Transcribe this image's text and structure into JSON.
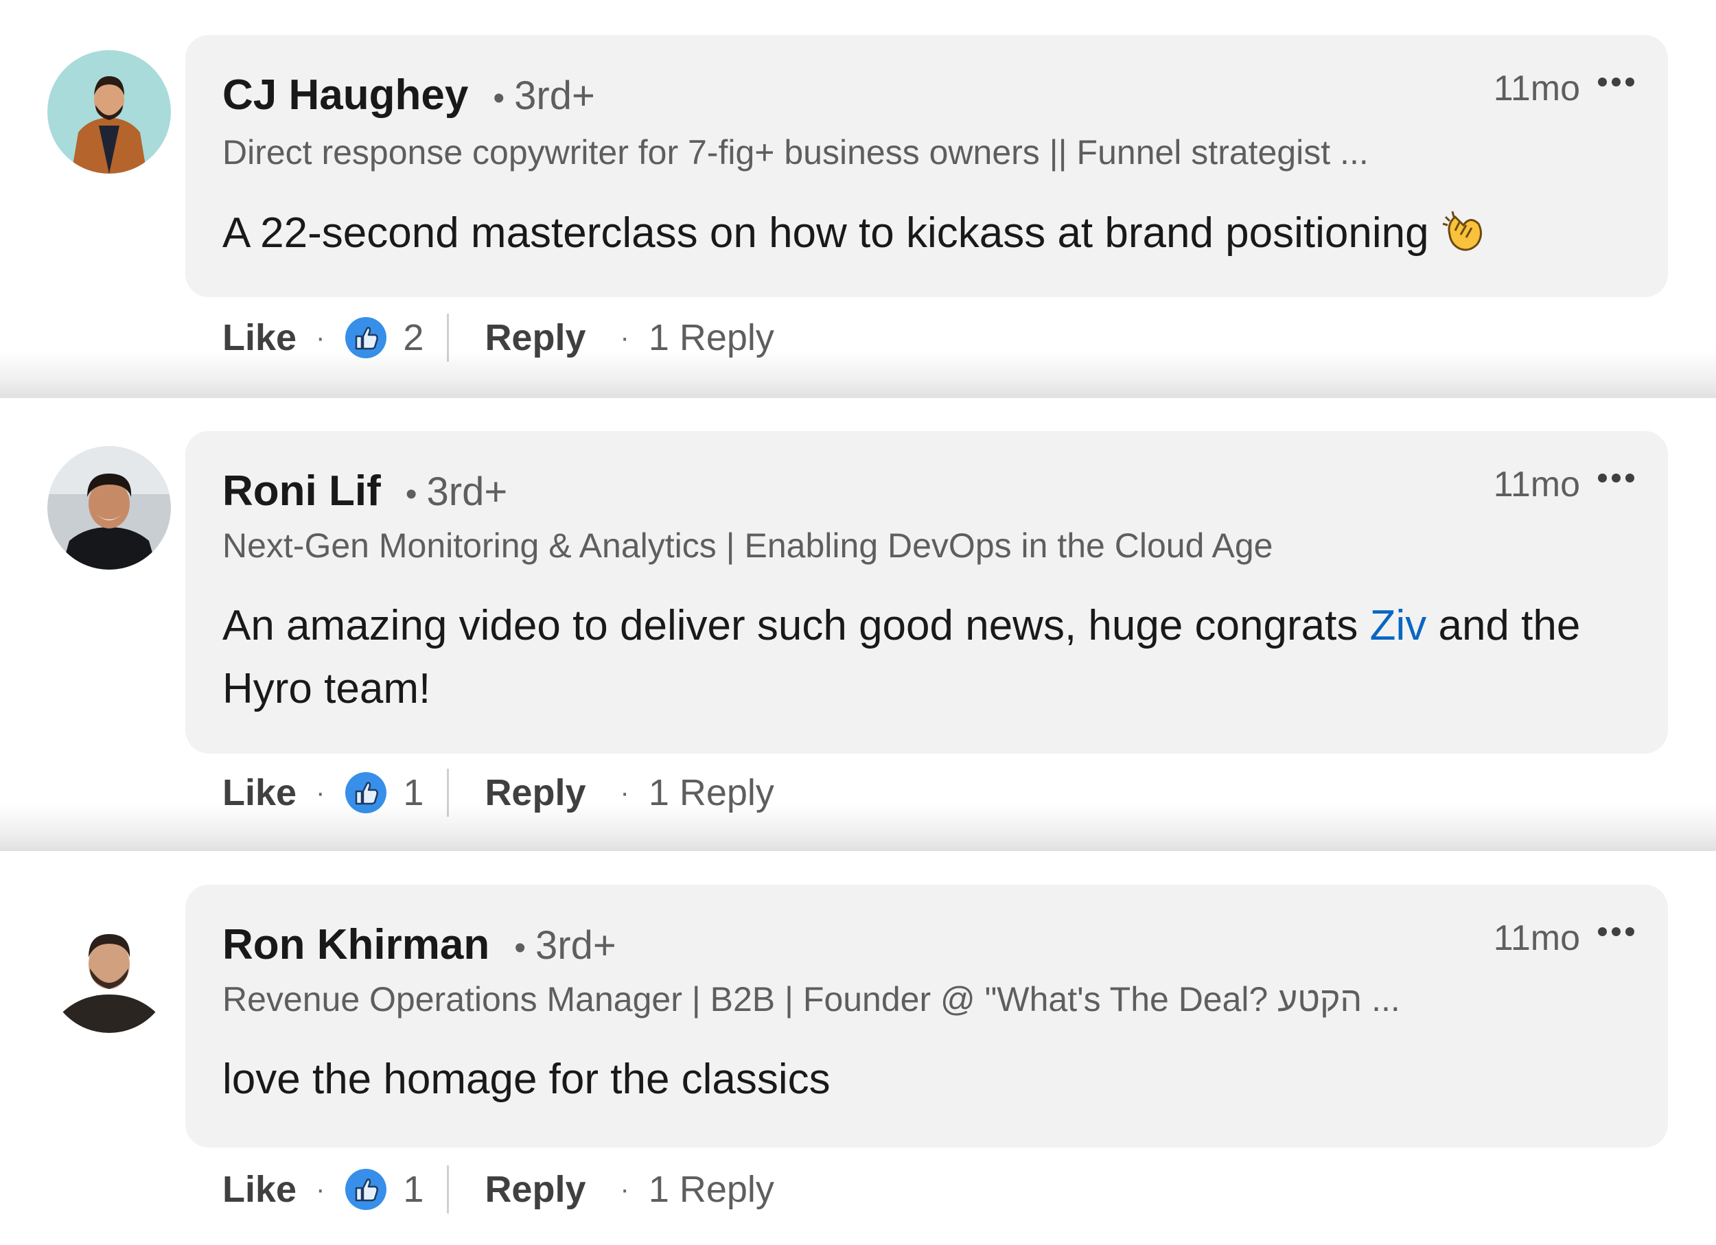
{
  "colors": {
    "bubble": "#f2f2f2",
    "mention": "#0a66c2",
    "like_blue": "#378fe9",
    "muted": "#5e5e5e"
  },
  "comments": [
    {
      "name": "CJ Haughey",
      "degree": "3rd+",
      "headline": "Direct response copywriter for 7-fig+ business owners || Funnel strategist ...",
      "time": "11mo",
      "text": "A 22-second masterclass on how to kickass at brand positioning",
      "emoji_icon": "clapping-hands-icon",
      "like_label": "Like",
      "like_count": "2",
      "reply_label": "Reply",
      "replies_label": "1 Reply"
    },
    {
      "name": "Roni Lif",
      "degree": "3rd+",
      "headline": "Next-Gen Monitoring & Analytics | Enabling DevOps in the Cloud Age",
      "time": "11mo",
      "text_before": "An amazing video to deliver such good news, huge congrats ",
      "mention": "Ziv",
      "text_after": " and the Hyro team!",
      "like_label": "Like",
      "like_count": "1",
      "reply_label": "Reply",
      "replies_label": "1 Reply"
    },
    {
      "name": "Ron Khirman",
      "degree": "3rd+",
      "headline": "Revenue Operations Manager | B2B | Founder @ \"What's The Deal? הקטע ...",
      "time": "11mo",
      "text": "love the homage for the classics",
      "like_label": "Like",
      "like_count": "1",
      "reply_label": "Reply",
      "replies_label": "1 Reply"
    }
  ],
  "icons": {
    "more": "more-options-icon",
    "like": "like-thumb-icon",
    "avatar": "avatar-photo"
  }
}
